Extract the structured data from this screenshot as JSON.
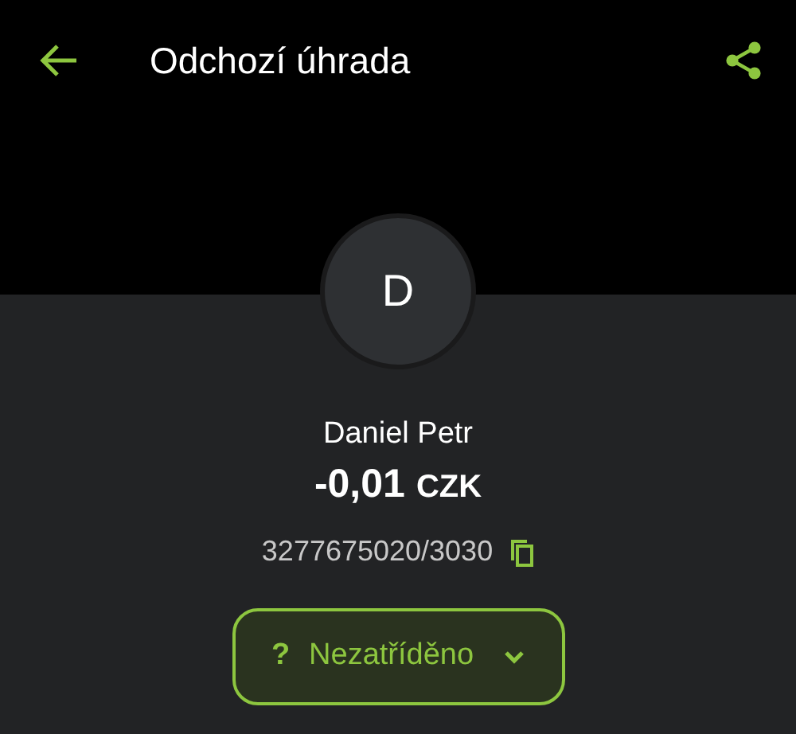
{
  "header": {
    "title": "Odchozí úhrada"
  },
  "avatar": {
    "initial": "D"
  },
  "counterparty": {
    "name": "Daniel Petr",
    "amount": "-0,01",
    "currency": "CZK",
    "account": "3277675020/3030"
  },
  "category": {
    "icon": "?",
    "label": "Nezatříděno"
  }
}
